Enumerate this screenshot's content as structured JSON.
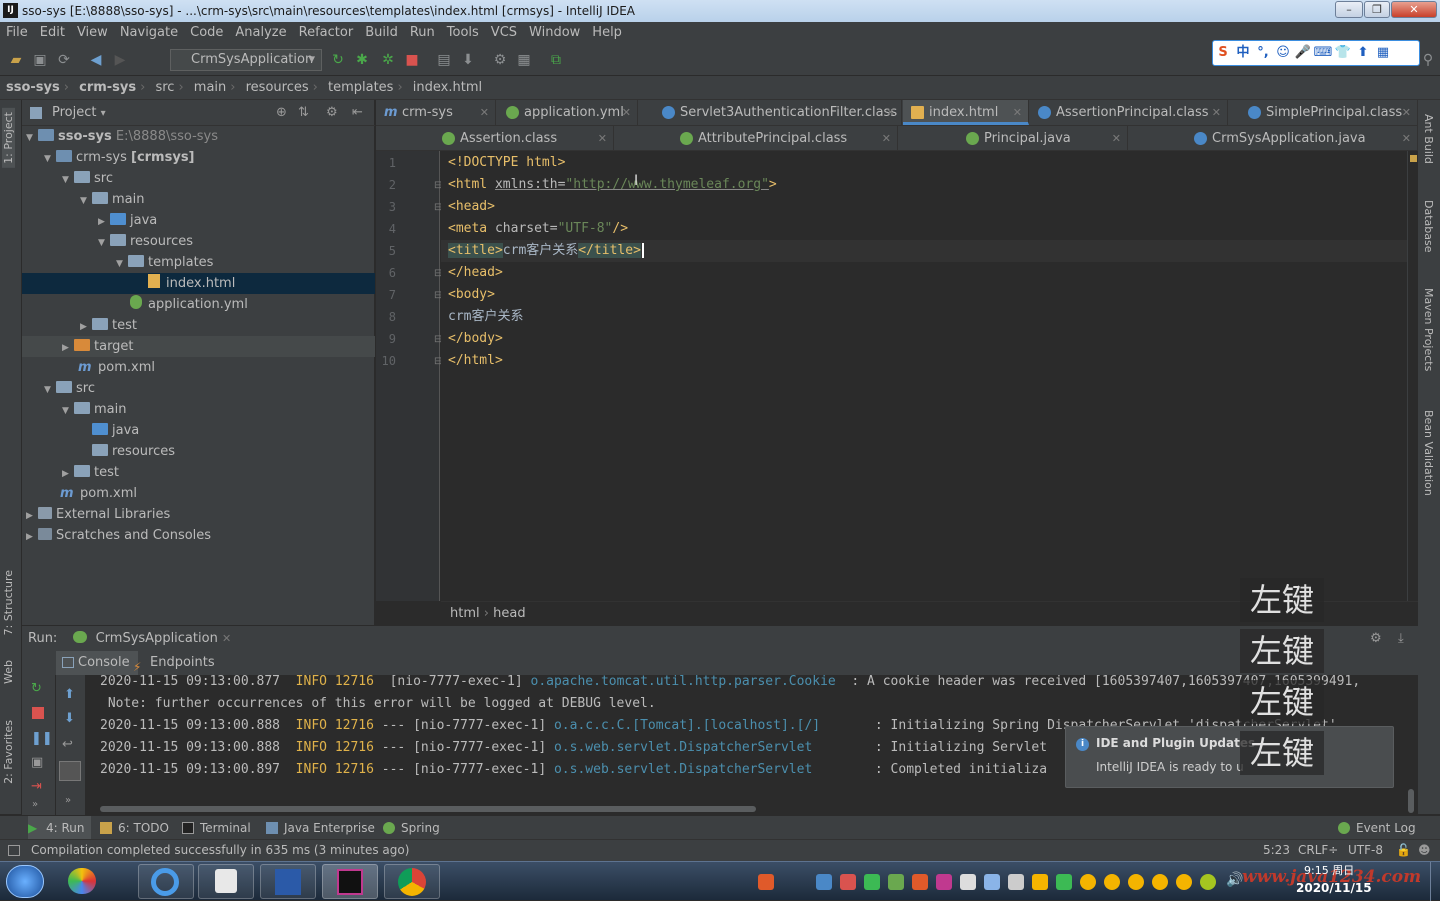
{
  "window": {
    "title": "sso-sys [E:\\8888\\sso-sys] - ...\\crm-sys\\src\\main\\resources\\templates\\index.html [crmsys] - IntelliJ IDEA",
    "logo": "IJ"
  },
  "menu": [
    "File",
    "Edit",
    "View",
    "Navigate",
    "Code",
    "Analyze",
    "Refactor",
    "Build",
    "Run",
    "Tools",
    "VCS",
    "Window",
    "Help"
  ],
  "toolbar": {
    "run_config": "CrmSysApplication"
  },
  "ime": {
    "items": [
      "中",
      "°,",
      "☺",
      "🎤",
      "⌨",
      "👕",
      "⬆",
      "▦"
    ]
  },
  "navbar": [
    "sso-sys",
    "crm-sys",
    "src",
    "main",
    "resources",
    "templates",
    "index.html"
  ],
  "project": {
    "header": "Project",
    "tree": [
      {
        "label": "sso-sys",
        "extra": "E:\\8888\\sso-sys",
        "bold": "true"
      },
      {
        "label": "crm-sys",
        "extra": "[crmsys]"
      },
      {
        "label": "src",
        "extra": ""
      },
      {
        "label": "main",
        "extra": ""
      },
      {
        "label": "java",
        "extra": ""
      },
      {
        "label": "resources",
        "extra": ""
      },
      {
        "label": "templates",
        "extra": ""
      },
      {
        "label": "index.html",
        "extra": ""
      },
      {
        "label": "application.yml",
        "extra": ""
      },
      {
        "label": "test",
        "extra": ""
      },
      {
        "label": "target",
        "extra": ""
      },
      {
        "label": "pom.xml",
        "extra": ""
      },
      {
        "label": "src",
        "extra": ""
      },
      {
        "label": "main",
        "extra": ""
      },
      {
        "label": "java",
        "extra": ""
      },
      {
        "label": "resources",
        "extra": ""
      },
      {
        "label": "test",
        "extra": ""
      },
      {
        "label": "pom.xml",
        "extra": ""
      },
      {
        "label": "External Libraries",
        "extra": ""
      },
      {
        "label": "Scratches and Consoles",
        "extra": ""
      }
    ]
  },
  "tabs_row1": [
    "crm-sys",
    "application.yml",
    "Servlet3AuthenticationFilter.class",
    "index.html",
    "AssertionPrincipal.class",
    "SimplePrincipal.class"
  ],
  "tabs_row2": [
    "Assertion.class",
    "AttributePrincipal.class",
    "Principal.java",
    "CrmSysApplication.java"
  ],
  "editor": {
    "line_numbers": [
      "1",
      "2",
      "3",
      "4",
      "5",
      "6",
      "7",
      "8",
      "9",
      "10"
    ],
    "l1": "<!DOCTYPE html>",
    "l2_a": "<html ",
    "l2_b": "xmlns:th",
    "l2_c": "=",
    "l2_d": "\"http://www.thymeleaf.org\"",
    "l2_e": ">",
    "l3": "<head>",
    "l4_a": "<meta ",
    "l4_b": "charset",
    "l4_c": "=",
    "l4_d": "\"UTF-8\"",
    "l4_e": "/>",
    "l5_a": "<title>",
    "l5_b": "crm客户关系",
    "l5_c": "</title>",
    "l6": "</head>",
    "l7": "<body>",
    "l8": "crm客户关系",
    "l9": "</body>",
    "l10": "</html>",
    "breadcrumb": [
      "html",
      "head"
    ]
  },
  "run": {
    "label": "Run:",
    "config": "CrmSysApplication",
    "tabs": [
      "Console",
      "Endpoints"
    ],
    "lines": [
      {
        "ts": "2020-11-15 09:13:00.877",
        "level": "INFO",
        "pid": "12716",
        "sep": "---",
        "thread": "[nio-7777-exec-1]",
        "cls": "o.apache.tomcat.util.http.parser.Cookie",
        "msg": ": A cookie header was received [1605397407,1605397407,1605399491,"
      },
      {
        "ts": "",
        "level": "",
        "pid": "",
        "sep": "",
        "thread": "",
        "cls": "",
        "msg": " Note: further occurrences of this error will be logged at DEBUG level."
      },
      {
        "ts": "2020-11-15 09:13:00.888",
        "level": "INFO",
        "pid": "12716",
        "sep": "---",
        "thread": "[nio-7777-exec-1]",
        "cls": "o.a.c.c.C.[Tomcat].[localhost].[/]",
        "msg": ": Initializing Spring DispatcherServlet 'dispatcherServlet'"
      },
      {
        "ts": "2020-11-15 09:13:00.888",
        "level": "INFO",
        "pid": "12716",
        "sep": "---",
        "thread": "[nio-7777-exec-1]",
        "cls": "o.s.web.servlet.DispatcherServlet",
        "msg": ": Initializing Servlet"
      },
      {
        "ts": "2020-11-15 09:13:00.897",
        "level": "INFO",
        "pid": "12716",
        "sep": "---",
        "thread": "[nio-7777-exec-1]",
        "cls": "o.s.web.servlet.DispatcherServlet",
        "msg": ": Completed initializa"
      }
    ]
  },
  "notification": {
    "title": "IDE and Plugin Updates",
    "body": "IntelliJ IDEA is ready to u"
  },
  "captions": [
    "左键",
    "左键",
    "左键",
    "左键"
  ],
  "bottom_tools": [
    "4: Run",
    "6: TODO",
    "Terminal",
    "Java Enterprise",
    "Spring",
    "Event Log"
  ],
  "status": {
    "message": "Compilation completed successfully in 635 ms (3 minutes ago)",
    "position": "5:23",
    "line_sep": "CRLF÷",
    "encoding": "UTF-8"
  },
  "side_labels": {
    "left": [
      "1: Project",
      "7: Structure",
      "Web",
      "2: Favorites"
    ],
    "right": [
      "Ant Build",
      "Database",
      "Maven Projects",
      "Bean Validation"
    ]
  },
  "taskbar": {
    "time": "9:15 周日",
    "date": "2020/11/15",
    "watermark": "www.java1234.com"
  }
}
